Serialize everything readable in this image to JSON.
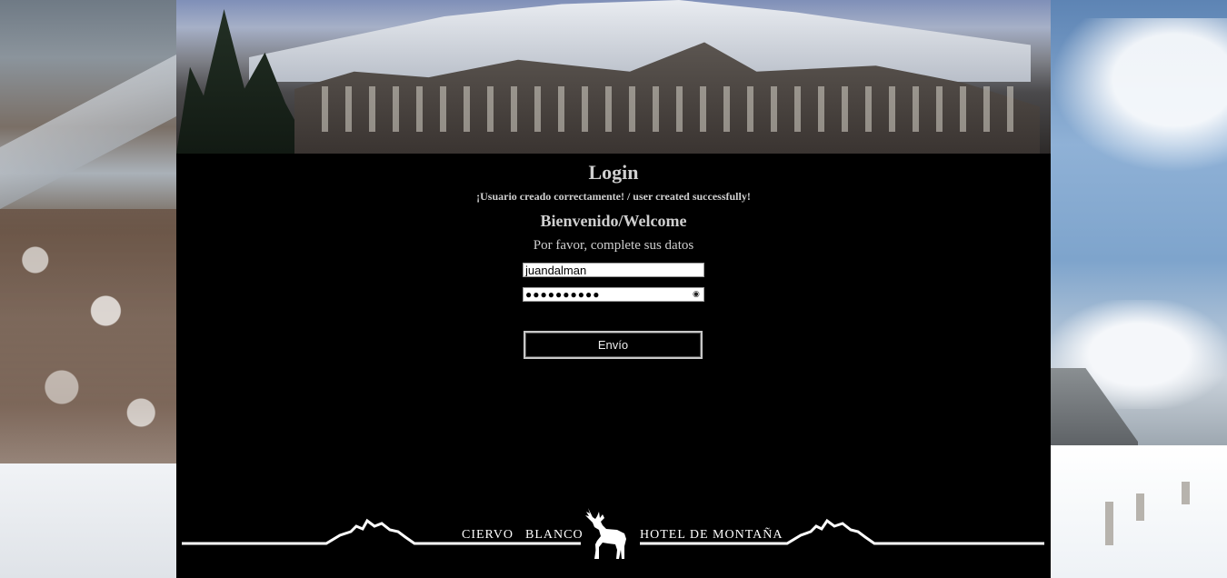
{
  "login": {
    "title": "Login",
    "message": "¡Usuario creado correctamente! / user created successfully!",
    "welcome": "Bienvenido/Welcome",
    "prompt": "Por favor, complete sus datos",
    "username_value": "juandalman",
    "password_value": "●●●●●●●●●●",
    "submit_label": "Envío"
  },
  "brand": {
    "name_part1": "CIERVO",
    "name_part2": "BLANCO",
    "tagline": "HOTEL DE MONTAÑA",
    "deer_icon": "deer-icon"
  }
}
